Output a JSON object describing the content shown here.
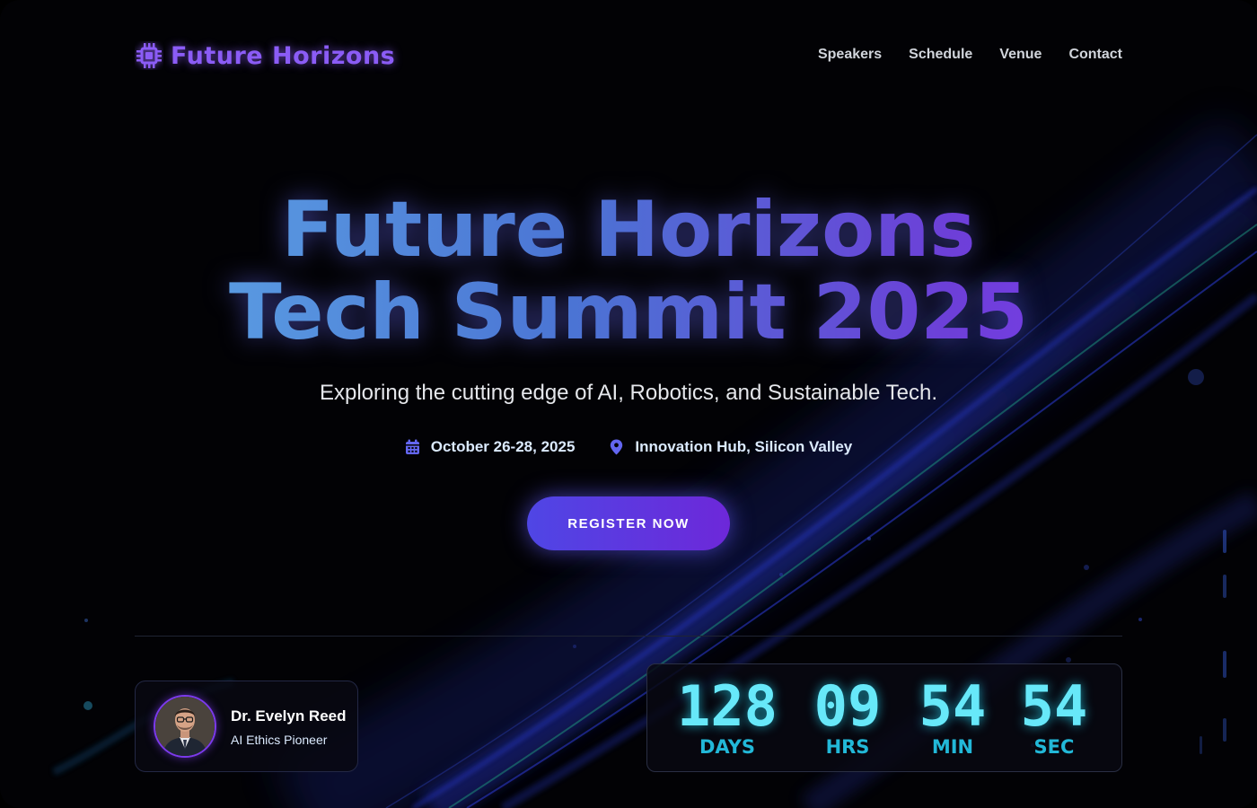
{
  "header": {
    "logo_text": "Future Horizons",
    "logo_icon": "cpu-chip-icon",
    "nav": [
      "Speakers",
      "Schedule",
      "Venue",
      "Contact"
    ]
  },
  "hero": {
    "title_line1": "Future Horizons",
    "title_line2": "Tech Summit 2025",
    "subtitle": "Exploring the cutting edge of AI, Robotics, and Sustainable Tech.",
    "date": "October 26-28, 2025",
    "date_icon": "calendar-icon",
    "location": "Innovation Hub, Silicon Valley",
    "location_icon": "map-pin-icon",
    "cta_label": "REGISTER NOW"
  },
  "speaker": {
    "name": "Dr. Evelyn Reed",
    "role": "AI Ethics Pioneer"
  },
  "countdown": {
    "days": "128",
    "days_label": "DAYS",
    "hours": "09",
    "hours_label": "HRS",
    "minutes": "54",
    "minutes_label": "MIN",
    "seconds": "54",
    "seconds_label": "SEC"
  },
  "colors": {
    "accent_purple": "#7c3aed",
    "accent_indigo": "#4f46e5",
    "countdown_cyan": "#67e8f9",
    "background": "#020205"
  }
}
